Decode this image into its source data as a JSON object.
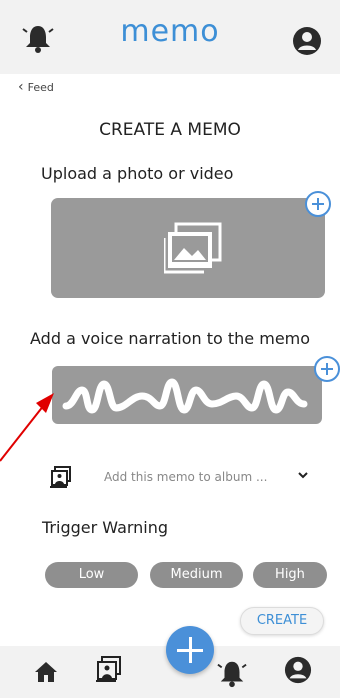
{
  "header": {
    "title": "memo",
    "icons": {
      "left": "bell-icon",
      "right": "profile-icon"
    }
  },
  "nav_back": {
    "label": "Feed"
  },
  "page": {
    "title": "CREATE A MEMO",
    "upload_label": "Upload a photo or video",
    "voice_label": "Add a voice narration to the memo"
  },
  "album": {
    "placeholder": "Add this memo to album ..."
  },
  "trigger": {
    "label": "Trigger Warning",
    "options": [
      "Low",
      "Medium",
      "High"
    ]
  },
  "actions": {
    "create_label": "CREATE"
  },
  "bottom_nav": {
    "items": [
      "home-icon",
      "album-icon",
      "add-icon",
      "bell-icon",
      "profile-icon"
    ]
  },
  "colors": {
    "accent": "#4a90d9",
    "title": "#3d8fd6",
    "bar": "#f2f2f2",
    "placeholder_box": "#9a9a9a",
    "pill": "#8f8f8f",
    "annotation_arrow": "#e00000"
  }
}
